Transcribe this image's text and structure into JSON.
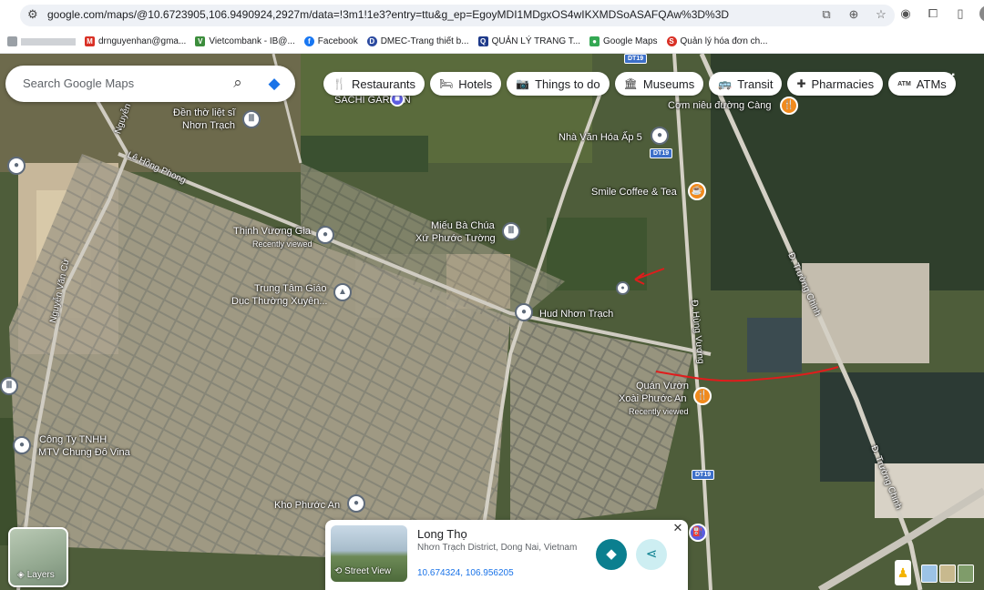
{
  "browser": {
    "url": "google.com/maps/@10.6723905,106.9490924,2927m/data=!3m1!1e3?entry=ttu&g_ep=EgoyMDI1MDgxOS4wIKXMDSoASAFQAw%3D%3D",
    "bookmarks": [
      {
        "label": "drnguyenhan@gma...",
        "icon": "mail-icon",
        "color": "#d93025"
      },
      {
        "label": "Vietcombank - IB@...",
        "icon": "vcb-icon",
        "color": "#3c8d3c"
      },
      {
        "label": "Facebook",
        "icon": "facebook-icon",
        "color": "#1877f2"
      },
      {
        "label": "DMEC-Trang thiết b...",
        "icon": "dmec-icon",
        "color": "#2b4aa0"
      },
      {
        "label": "QUẢN LÝ TRANG T...",
        "icon": "page-icon",
        "color": "#1e3a8a"
      },
      {
        "label": "Google Maps",
        "icon": "maps-icon",
        "color": "#34a853"
      },
      {
        "label": "Quản lý hóa đơn ch...",
        "icon": "invoice-icon",
        "color": "#d93025"
      }
    ]
  },
  "search": {
    "placeholder": "Search Google Maps"
  },
  "chips": [
    {
      "label": "Restaurants",
      "icon": "fork-knife-icon",
      "glyph": "🍴"
    },
    {
      "label": "Hotels",
      "icon": "bed-icon",
      "glyph": "🛏"
    },
    {
      "label": "Things to do",
      "icon": "camera-icon",
      "glyph": "📷"
    },
    {
      "label": "Museums",
      "icon": "museum-icon",
      "glyph": "🏛"
    },
    {
      "label": "Transit",
      "icon": "bus-icon",
      "glyph": "🚌"
    },
    {
      "label": "Pharmacies",
      "icon": "pharmacy-icon",
      "glyph": "✚"
    },
    {
      "label": "ATMs",
      "icon": "atm-icon",
      "glyph": "ATM"
    }
  ],
  "places": {
    "sachi": "SACHI GARDEN",
    "den_tho_1": "Đền thờ liệt sĩ",
    "den_tho_2": "Nhơn Trạch",
    "com_nieu": "Cơm niêu đường Càng",
    "nha_van_hoa": "Nhà Văn Hóa Ấp 5",
    "smile": "Smile Coffee & Tea",
    "thinh_vuong": "Thịnh Vượng Gia",
    "thinh_vuong_sub": "Recently viewed",
    "mieu_1": "Miếu Bà Chúa",
    "mieu_2": "Xứ Phước Tường",
    "trung_tam_1": "Trung Tâm Giáo",
    "trung_tam_2": "Dục Thường Xuyên...",
    "hud": "Hud Nhơn Trạch",
    "quan_vuon_1": "Quán Vườn",
    "quan_vuon_2": "Xoài Phước An",
    "quan_vuon_sub": "Recently viewed",
    "cong_ty_1": "Công Ty TNHH",
    "cong_ty_2": "MTV Chung Đô Vina",
    "kho": "Kho Phước An"
  },
  "roads": {
    "nguyen": "Nguyễn",
    "le_hong_phong": "Lê Hồng Phong",
    "nguyen_van_cu": "Nguyễn Văn Cừ",
    "hung_vuong": "Đ. Hùng Vương",
    "truong_chinh_1": "Đ. Trường Chinh",
    "truong_chinh_2": "Đ. Trường Chinh",
    "dt19": "DT19",
    "dt769": "DT19",
    "dt19_b": "DT19"
  },
  "layers": {
    "label": "Layers"
  },
  "card": {
    "title": "Long Thọ",
    "subtitle": "Nhơn Trạch District, Dong Nai, Vietnam",
    "coords": "10.674324, 106.956205",
    "thumb_label": "Street View"
  }
}
